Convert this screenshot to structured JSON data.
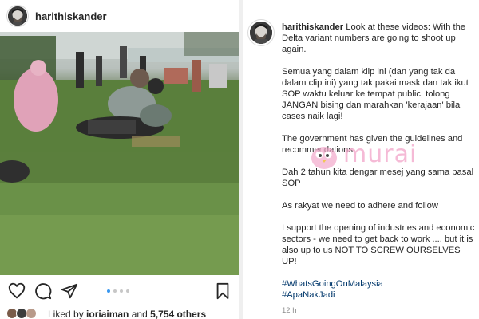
{
  "left_post": {
    "username": "harithiskander",
    "likes": {
      "prefix": "Liked by ",
      "user": "ioriaiman",
      "and": " and ",
      "count": "5,754 others"
    },
    "carousel": {
      "total": 4,
      "active_index": 0
    },
    "icons": [
      "heart-icon",
      "comment-icon",
      "share-icon",
      "bookmark-icon"
    ]
  },
  "right_post": {
    "username": "harithiskander",
    "caption_first": "Look at these videos: With the Delta variant numbers are going to shoot up again.",
    "paragraphs": [
      "Semua yang dalam klip ini (dan yang tak da dalam clip ini) yang tak pakai mask dan tak ikut SOP waktu keluar ke tempat public, tolong JANGAN bising dan marahkan 'kerajaan' bila cases naik lagi!",
      "The government has given the guidelines and recommendations.",
      "Dah 2 tahun kita dengar mesej yang sama pasal SOP",
      "As rakyat we need to adhere and follow",
      "I support the opening of industries and economic sectors - we need to get back to work .... but it is also up to us NOT TO SCREW OURSELVES UP!"
    ],
    "hashtags": [
      "#WhatsGoingOnMalaysia",
      "#ApaNakJadi"
    ],
    "time": "12 h"
  },
  "watermark": {
    "text": "murai"
  },
  "colors": {
    "link": "#00376b",
    "muted": "#8e8e8e",
    "carousel_active": "#3897f0",
    "watermark": "#f3a6c9"
  }
}
